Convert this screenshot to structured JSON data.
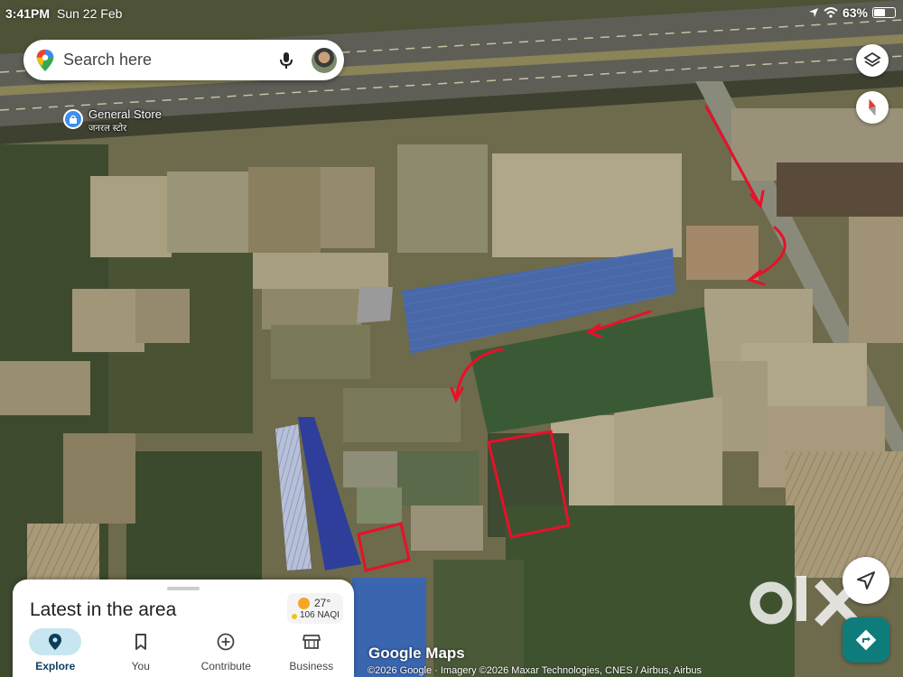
{
  "status_bar": {
    "time": "3:41PM",
    "date": "Sun 22 Feb",
    "battery": "63%",
    "battery_level": 0.63
  },
  "search": {
    "placeholder": "Search here"
  },
  "place": {
    "name": "General Store",
    "name_local": "जनरल स्टोर"
  },
  "sheet": {
    "title": "Latest in the area",
    "weather": {
      "temperature": "27°",
      "aqi": "106 NAQI"
    },
    "nav": [
      {
        "label": "Explore",
        "icon": "location-pin-icon",
        "active": true
      },
      {
        "label": "You",
        "icon": "bookmark-icon",
        "active": false
      },
      {
        "label": "Contribute",
        "icon": "add-circle-icon",
        "active": false
      },
      {
        "label": "Business",
        "icon": "storefront-icon",
        "active": false
      }
    ]
  },
  "brand": "Google Maps",
  "attribution": "©2026 Google · Imagery ©2026 Maxar Technologies, CNES / Airbus, Airbus",
  "watermark": "OLX",
  "colors": {
    "annotation": "#e8102a",
    "directions_button": "#0f7c7c",
    "explore_active": "#c8e6f0",
    "roof_blue": "#3a5a9a"
  }
}
